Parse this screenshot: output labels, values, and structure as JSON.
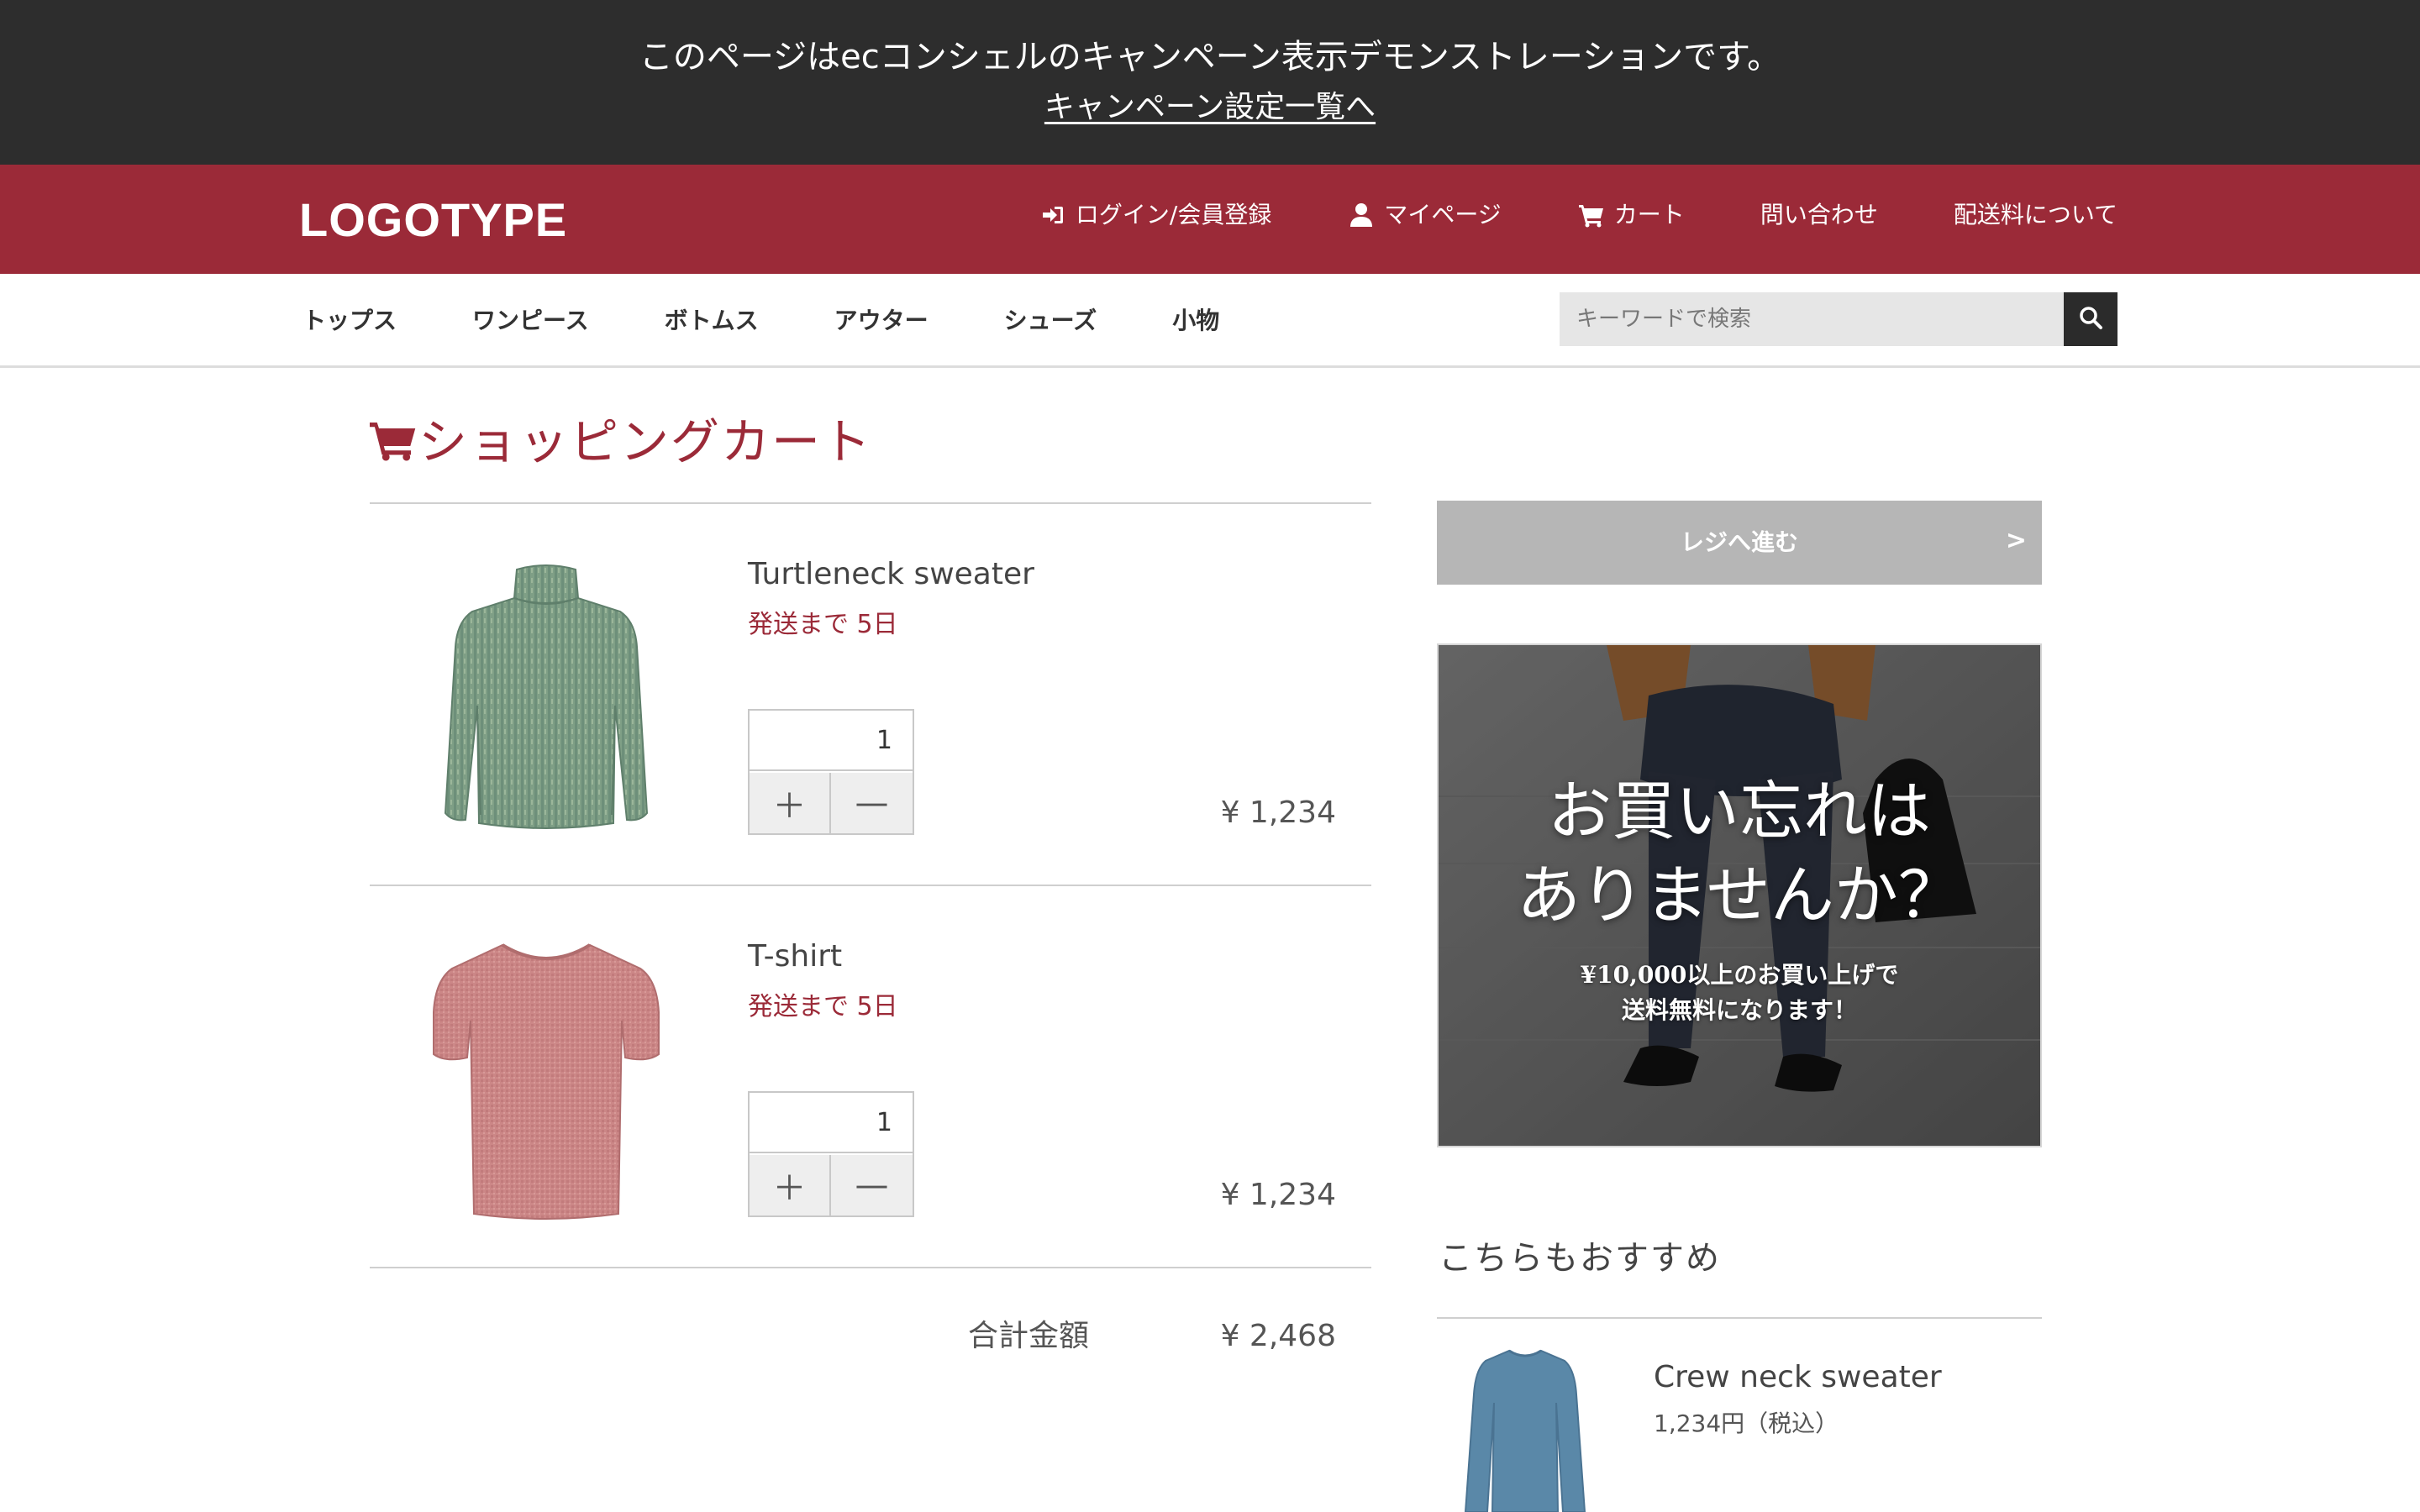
{
  "demo_banner": {
    "text": "このページはecコンシェルのキャンペーン表示デモンストレーションです。",
    "link": "キャンペーン設定一覧へ"
  },
  "header": {
    "logo": "LOGOTYPE",
    "nav": {
      "login": "ログイン/会員登録",
      "mypage": "マイページ",
      "cart": "カート",
      "contact": "問い合わせ",
      "shipping": "配送料について"
    }
  },
  "categories": [
    "トップス",
    "ワンピース",
    "ボトムス",
    "アウター",
    "シューズ",
    "小物"
  ],
  "search": {
    "placeholder": "キーワードで検索"
  },
  "cart": {
    "title": "ショッピングカート",
    "items": [
      {
        "name": "Turtleneck sweater",
        "shipping": "発送まで 5日",
        "quantity": "1",
        "plus": "＋",
        "minus": "—",
        "price": "¥ 1,234"
      },
      {
        "name": "T-shirt",
        "shipping": "発送まで 5日",
        "quantity": "1",
        "plus": "＋",
        "minus": "—",
        "price": "¥ 1,234"
      }
    ],
    "total_label": "合計金額",
    "total_value": "¥ 2,468"
  },
  "sidebar": {
    "checkout_label": "レジへ進む",
    "checkout_arrow": ">",
    "banner": {
      "headline_1": "お買い忘れは",
      "headline_2": "ありませんか？",
      "sub_1": "¥10,000以上のお買い上げで",
      "sub_2": "送料無料になります！"
    },
    "recommend": {
      "title": "こちらもおすすめ",
      "items": [
        {
          "name": "Crew neck sweater",
          "price": "1,234円（税込）"
        }
      ]
    }
  },
  "colors": {
    "brand": "#9b2a38",
    "demo_bar": "#2d2d2d",
    "sweater": "#7f9f86",
    "tshirt": "#cc8787",
    "crew_sweater": "#5a88a8"
  },
  "icons": [
    "sign-in-icon",
    "user-icon",
    "cart-icon",
    "search-icon",
    "cart-title-icon"
  ]
}
